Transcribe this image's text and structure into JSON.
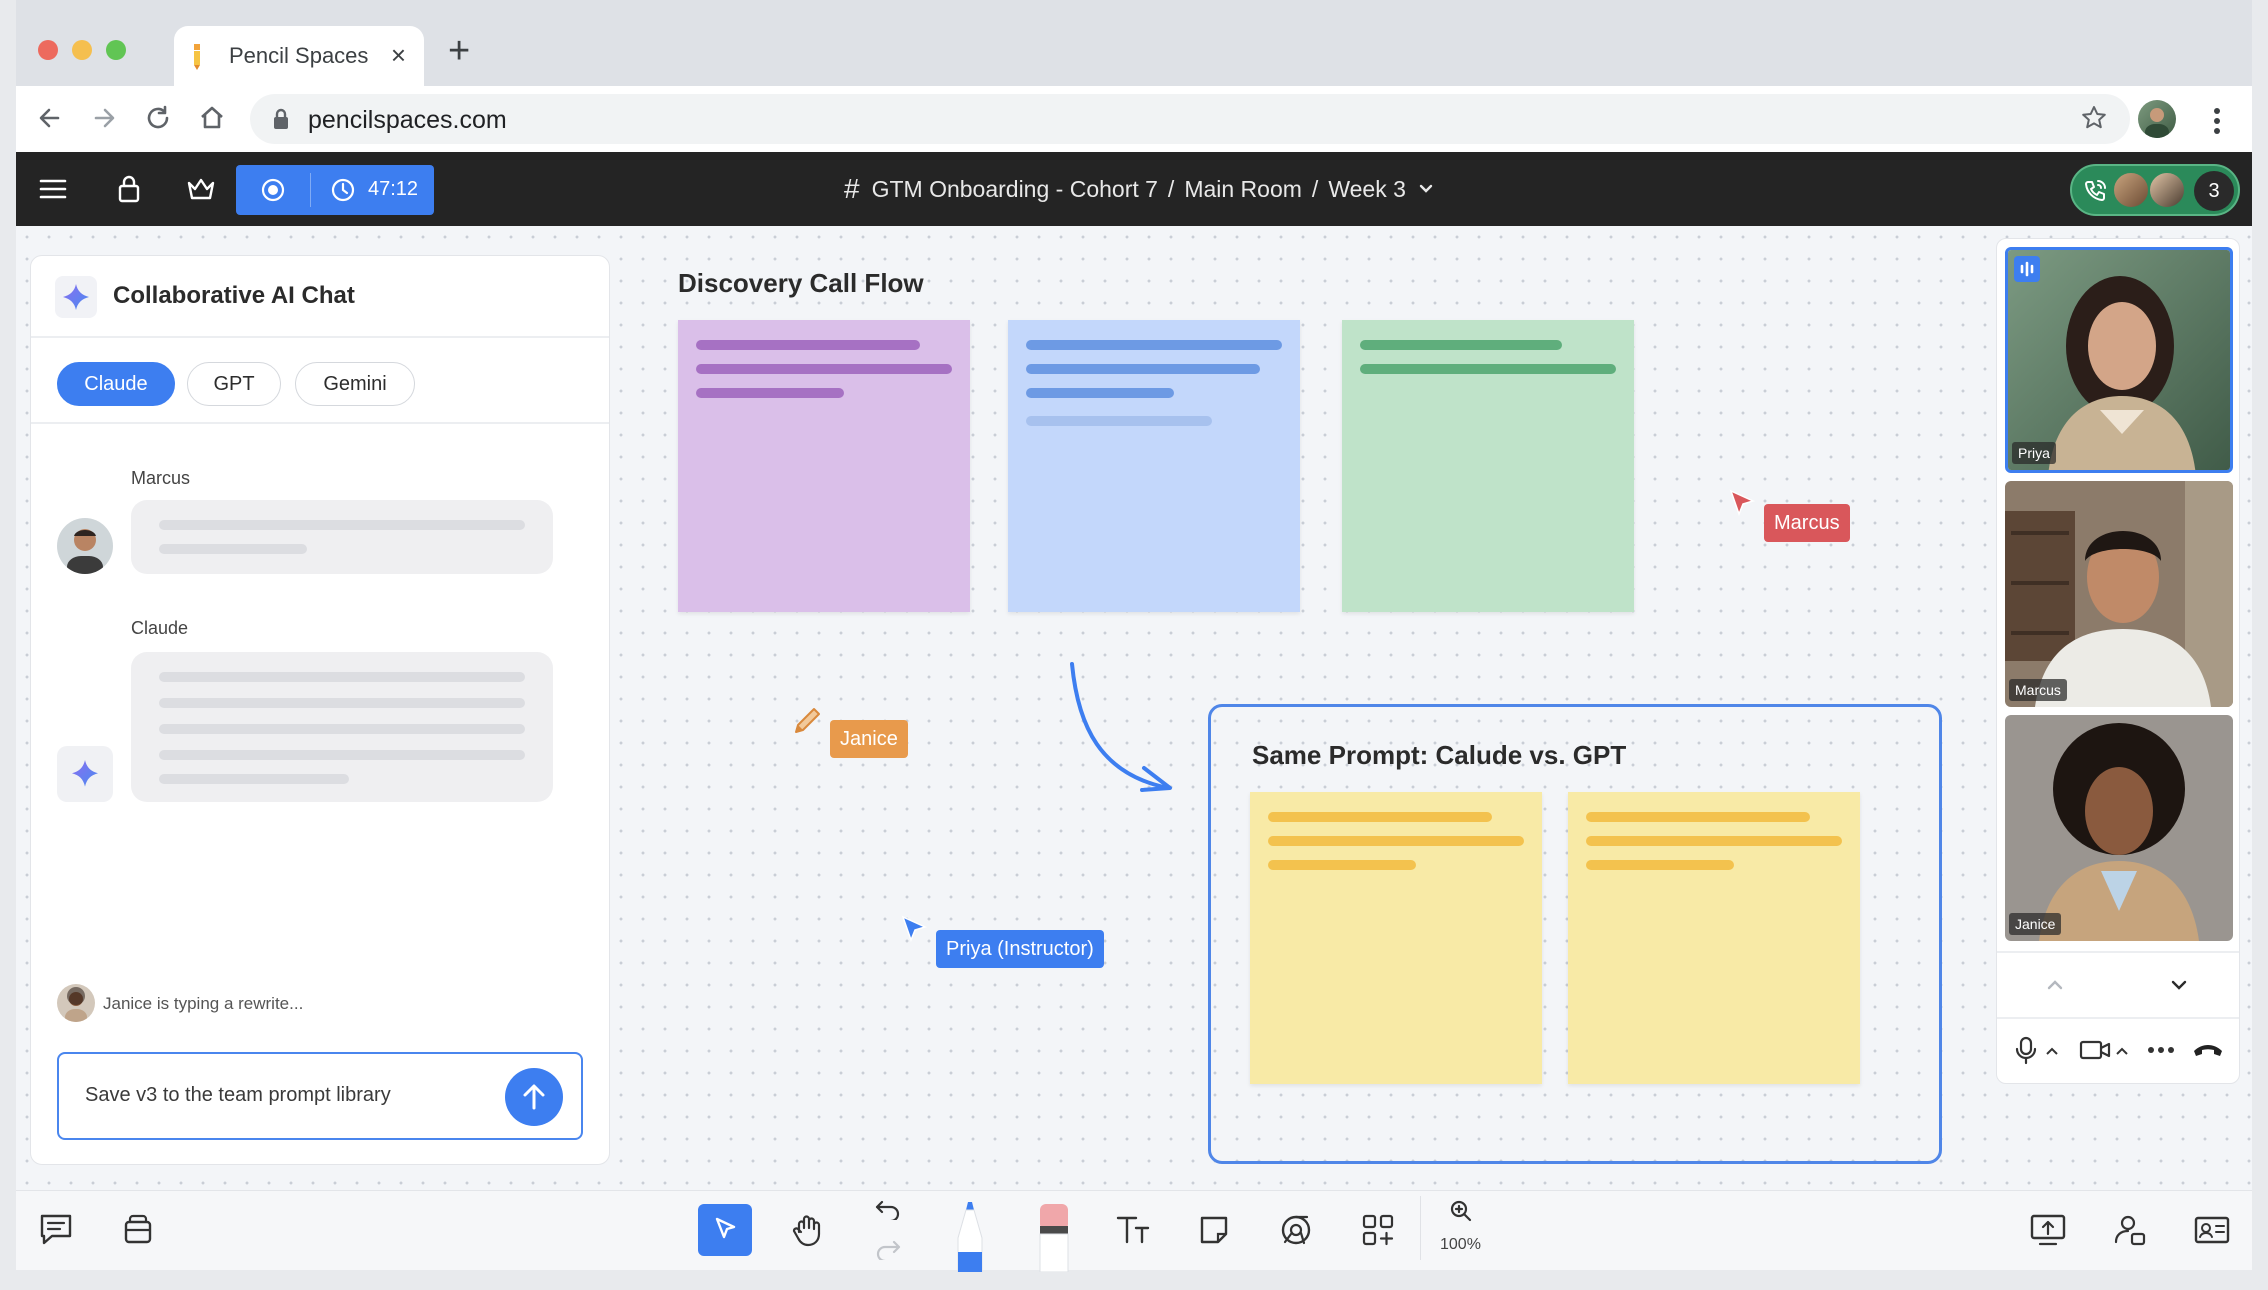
{
  "browser": {
    "tab_title": "Pencil Spaces",
    "tab_close": "×",
    "new_tab": "+",
    "url": "pencilspaces.com"
  },
  "app": {
    "timer": "47:12",
    "breadcrumb": {
      "room_group": "GTM Onboarding - Cohort 7",
      "room": "Main Room",
      "page": "Week 3",
      "separator": "/"
    },
    "participant_count": "3",
    "accent_color": "#3d7ef0"
  },
  "chat": {
    "title": "Collaborative AI Chat",
    "models": [
      "Claude",
      "GPT",
      "Gemini"
    ],
    "active_model": "Claude",
    "messages": [
      {
        "author": "Marcus"
      },
      {
        "author": "Claude"
      }
    ],
    "typing_status": "Janice is typing a rewrite...",
    "input_value": "Save v3 to the team prompt library"
  },
  "board": {
    "title": "Discovery Call Flow",
    "frame_title": "Same Prompt: Calude vs. GPT",
    "cursors": [
      {
        "name": "Marcus",
        "color": "#d9575b"
      },
      {
        "name": "Janice",
        "color": "#e89a4c"
      },
      {
        "name": "Priya (Instructor)",
        "color": "#3d7ef0"
      }
    ],
    "sticky_colors": {
      "purple": "#dabfe9",
      "blue": "#c3d7fb",
      "green": "#bfe3c9",
      "yellow": "#f8eaa6"
    }
  },
  "video": {
    "participants": [
      "Priya",
      "Marcus",
      "Janice"
    ]
  },
  "bottom_toolbar": {
    "zoom": "100%"
  }
}
